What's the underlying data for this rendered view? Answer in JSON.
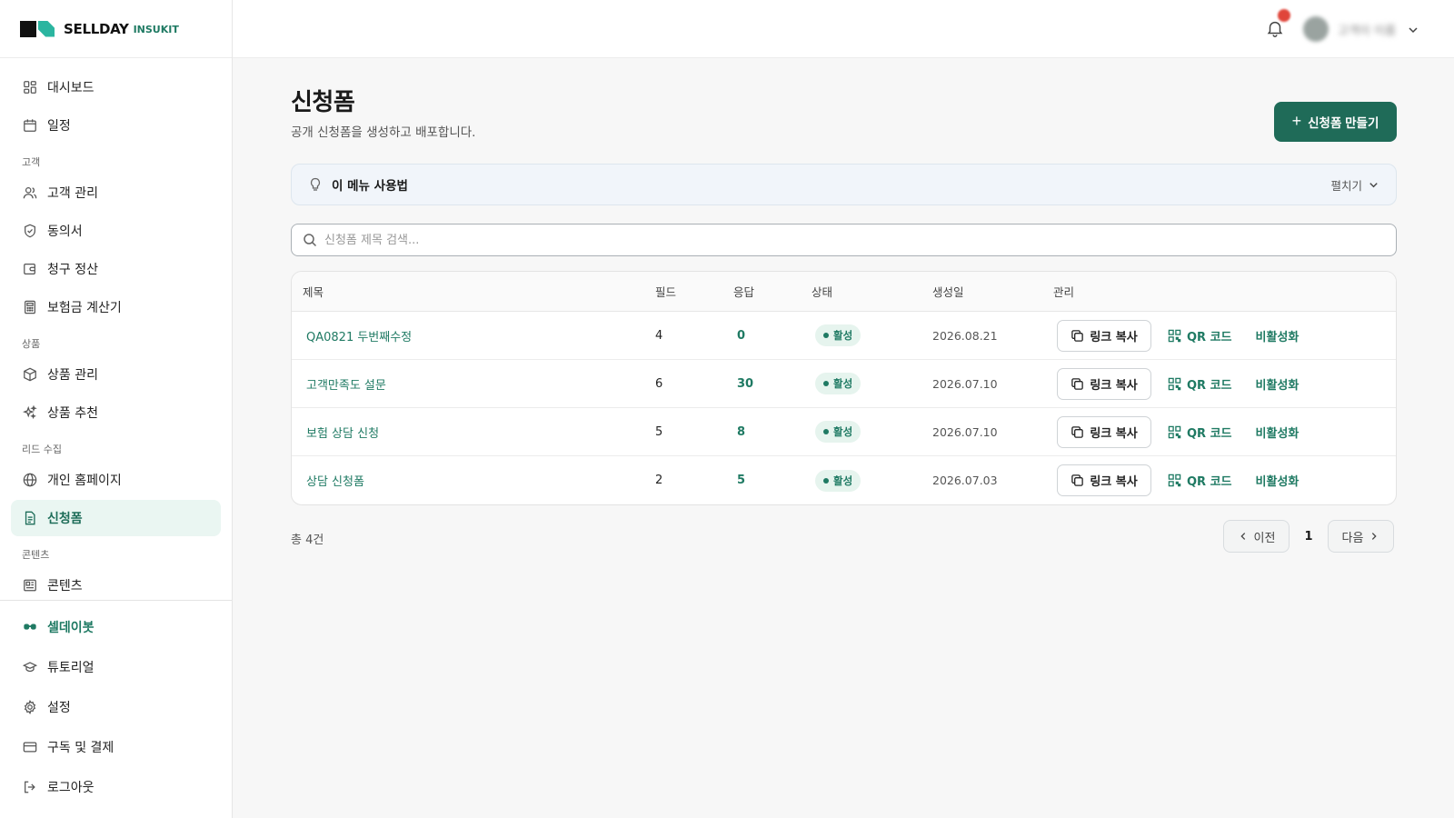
{
  "brand": {
    "name": "SELLDAY",
    "sub": "INSUKIT"
  },
  "header": {
    "user_name": "고객이 이름",
    "notification_icon": "bell-icon"
  },
  "sidebar": {
    "top_items": [
      {
        "label": "대시보드",
        "icon": "dashboard-icon"
      },
      {
        "label": "일정",
        "icon": "calendar-icon"
      }
    ],
    "section_customer": "고객",
    "customer_items": [
      {
        "label": "고객 관리",
        "icon": "users-icon"
      },
      {
        "label": "동의서",
        "icon": "shield-icon"
      },
      {
        "label": "청구 정산",
        "icon": "wallet-icon"
      },
      {
        "label": "보험금 계산기",
        "icon": "calculator-icon"
      }
    ],
    "section_product": "상품",
    "product_items": [
      {
        "label": "상품 관리",
        "icon": "box-icon"
      },
      {
        "label": "상품 추천",
        "icon": "sparkle-icon"
      }
    ],
    "section_lead": "리드 수집",
    "lead_items": [
      {
        "label": "개인 홈페이지",
        "icon": "globe-icon"
      },
      {
        "label": "신청폼",
        "icon": "form-icon"
      }
    ],
    "section_content": "콘텐츠",
    "content_items": [
      {
        "label": "콘텐츠",
        "icon": "content-icon"
      }
    ],
    "bottom_items": [
      {
        "label": "셀데이봇",
        "icon": "bot-icon"
      },
      {
        "label": "튜토리얼",
        "icon": "graduation-cap-icon"
      },
      {
        "label": "설정",
        "icon": "gear-icon"
      },
      {
        "label": "구독 및 결제",
        "icon": "credit-card-icon"
      },
      {
        "label": "로그아웃",
        "icon": "logout-icon"
      }
    ]
  },
  "page": {
    "title": "신청폼",
    "subtitle": "공개 신청폼을 생성하고 배포합니다.",
    "create_label": "신청폼 만들기"
  },
  "howto": {
    "title": "이 메뉴 사용법",
    "toggle_label": "펼치기"
  },
  "search": {
    "placeholder": "신청폼 제목 검색..."
  },
  "table": {
    "headers": {
      "title": "제목",
      "fields": "필드",
      "responses": "응답",
      "status": "상태",
      "created": "생성일",
      "manage": "관리"
    },
    "actions": {
      "copy_link": "링크 복사",
      "qr": "QR 코드",
      "deactivate": "비활성화"
    },
    "rows": [
      {
        "title": "QA0821 두번째수정",
        "fields": "4",
        "responses": "0",
        "status": "활성",
        "created": "2026.08.21"
      },
      {
        "title": "고객만족도 설문",
        "fields": "6",
        "responses": "30",
        "status": "활성",
        "created": "2026.07.10"
      },
      {
        "title": "보험 상담 신청",
        "fields": "5",
        "responses": "8",
        "status": "활성",
        "created": "2026.07.10"
      },
      {
        "title": "상담 신청폼",
        "fields": "2",
        "responses": "5",
        "status": "활성",
        "created": "2026.07.03"
      }
    ]
  },
  "footer": {
    "total": "총 4건",
    "prev": "이전",
    "page": "1",
    "next": "다음"
  },
  "colors": {
    "accent": "#1f6b58",
    "accent_text": "#1f7a63",
    "active_bg": "#eaf6f2"
  }
}
